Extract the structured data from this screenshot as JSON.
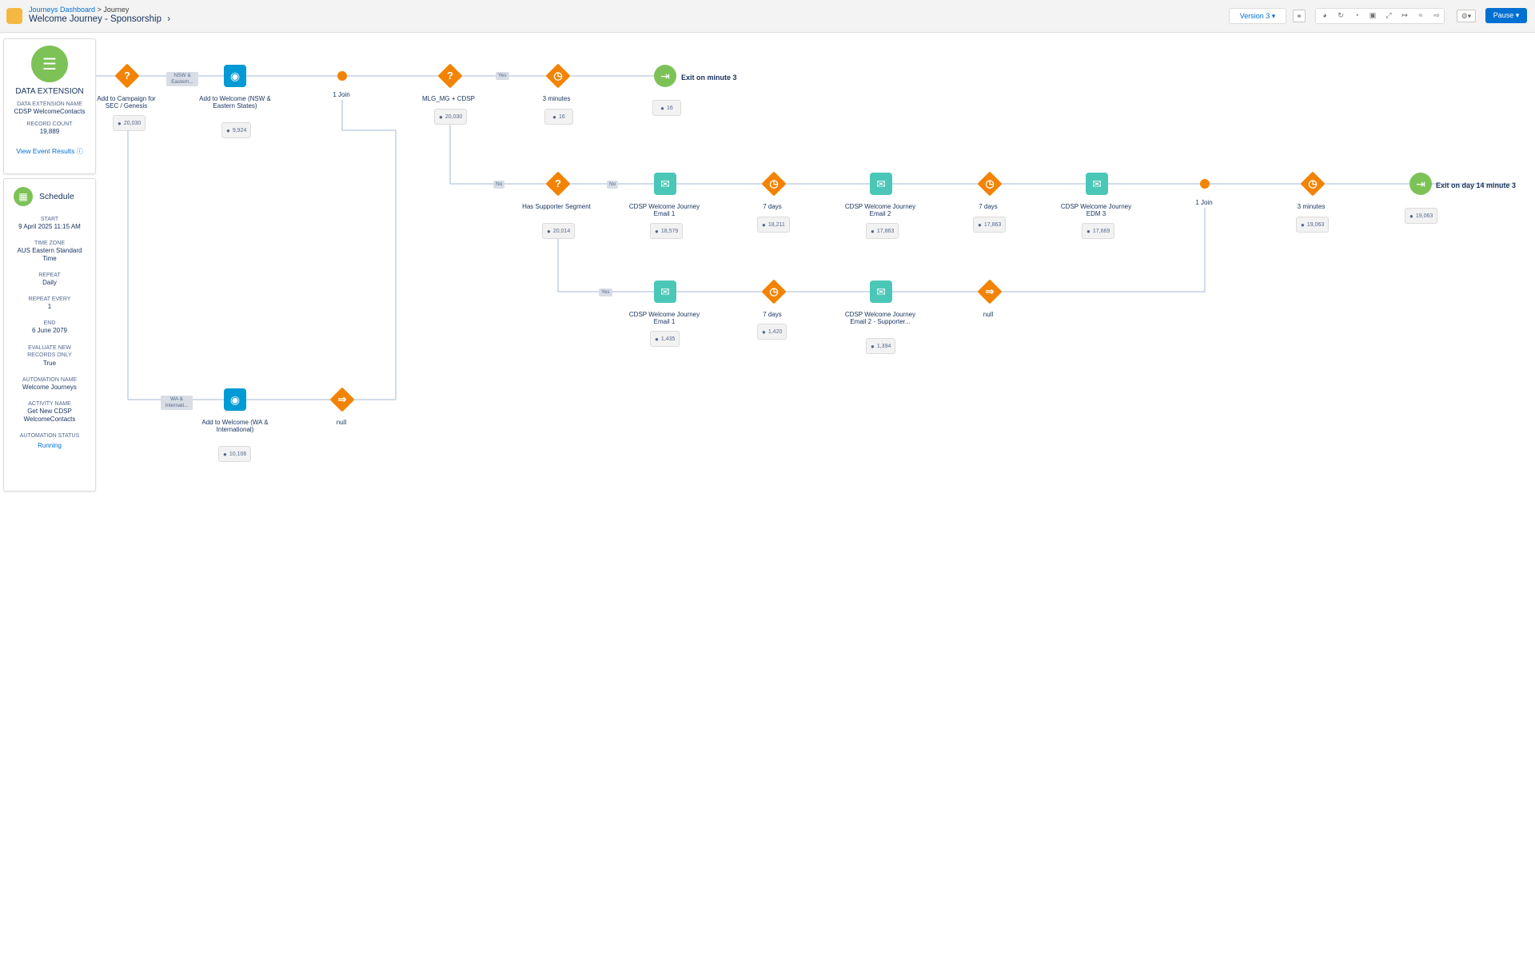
{
  "header": {
    "breadcrumb_root": "Journeys Dashboard",
    "breadcrumb_sep": ">",
    "breadcrumb_current": "Journey",
    "title": "Welcome Journey - Sponsorship",
    "version_label": "Version 3",
    "pause_label": "Pause"
  },
  "entry": {
    "source_title": "DATA EXTENSION",
    "de_name_label": "DATA EXTENSION NAME",
    "de_name": "CDSP WelcomeContacts",
    "record_count_label": "RECORD COUNT",
    "record_count": "19,889",
    "view_results": "View Event Results"
  },
  "schedule": {
    "title": "Schedule",
    "fields": [
      {
        "label": "START",
        "value": "9 April 2025 11:15 AM"
      },
      {
        "label": "TIME ZONE",
        "value": "AUS Eastern Standard Time"
      },
      {
        "label": "REPEAT",
        "value": "Daily"
      },
      {
        "label": "REPEAT EVERY",
        "value": "1"
      },
      {
        "label": "END",
        "value": "6 June 2079"
      },
      {
        "label": "EVALUATE NEW RECORDS ONLY",
        "value": "True"
      },
      {
        "label": "AUTOMATION NAME",
        "value": "Welcome Journeys"
      },
      {
        "label": "ACTIVITY NAME",
        "value": "Get New CDSP WelcomeContacts"
      },
      {
        "label": "AUTOMATION STATUS",
        "value": "Running"
      }
    ]
  },
  "nodes": {
    "split1": {
      "label": "Add to Campaign for SEC / Genesis",
      "count": "20,030"
    },
    "contact1": {
      "label": "Add to Welcome (NSW & Eastern States)",
      "count": "9,924"
    },
    "join1": {
      "label": "1 Join"
    },
    "split2": {
      "label": "MLG_MG + CDSP",
      "count": "20,030"
    },
    "wait1": {
      "label": "3 minutes",
      "count": "16"
    },
    "exit1": {
      "label": "Exit on minute 3",
      "count": "16"
    },
    "split3": {
      "label": "Has Supporter Segment",
      "count": "20,014"
    },
    "email1": {
      "label": "CDSP Welcome Journey Email 1",
      "count": "18,579"
    },
    "wait2": {
      "label": "7 days",
      "count": "18,211"
    },
    "email2": {
      "label": "CDSP Welcome Journey Email 2",
      "count": "17,863"
    },
    "wait3": {
      "label": "7 days",
      "count": "17,863"
    },
    "email3": {
      "label": "CDSP Welcome Journey EDM 3",
      "count": "17,669"
    },
    "join2": {
      "label": "1 Join"
    },
    "wait4": {
      "label": "3 minutes",
      "count": "19,063"
    },
    "exit2": {
      "label": "Exit on day 14 minute 3",
      "count": "19,063"
    },
    "email4": {
      "label": "CDSP Welcome Journey Email 1",
      "count": "1,435"
    },
    "wait5": {
      "label": "7 days",
      "count": "1,420"
    },
    "email5": {
      "label": "CDSP Welcome Journey Email 2 - Supporter...",
      "count": "1,394"
    },
    "jump1": {
      "label": "null"
    },
    "contact2": {
      "label": "Add to Welcome (WA & International)",
      "count": "10,106"
    },
    "jump2": {
      "label": "null"
    }
  },
  "paths": {
    "nsw": "NSW & Eastern...",
    "wa": "WA & Internati...",
    "yes1": "Yes",
    "no1": "No",
    "no2": "No",
    "yes2": "Yes"
  },
  "colors": {
    "decision": "#f38303",
    "email": "#4bc7b7",
    "contact": "#009ad4",
    "exit": "#7dc257",
    "primary": "#0070d2"
  }
}
